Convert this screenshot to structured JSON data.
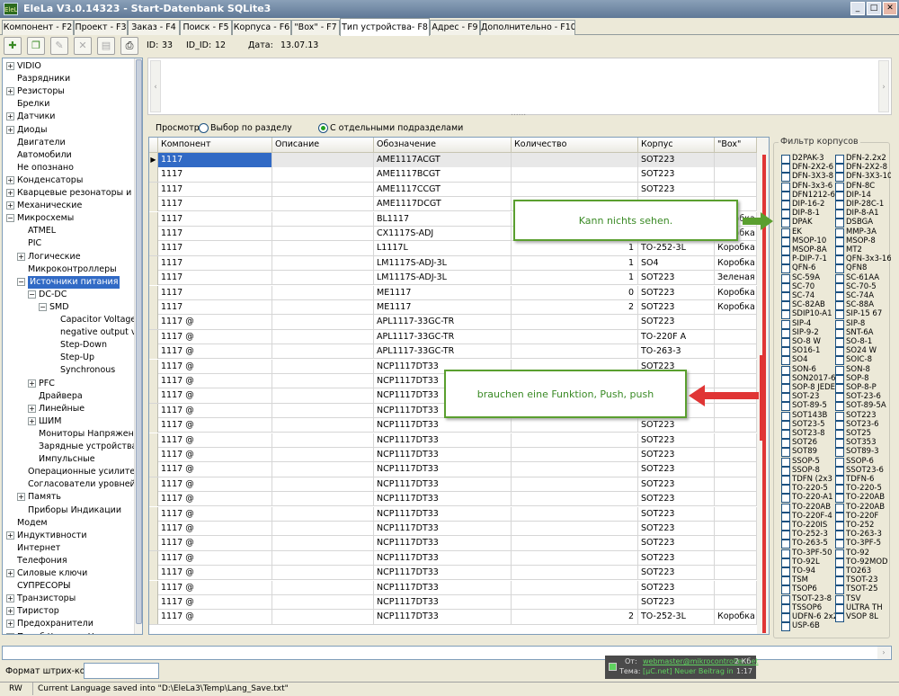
{
  "window": {
    "title": "EleLa V3.0.14323 - Start-Datenbank SQLite3",
    "app_icon_text": "EleLa",
    "minimize_label": "_",
    "maximize_label": "□",
    "close_label": "✕"
  },
  "tabs": [
    {
      "label": "Компонент - F2"
    },
    {
      "label": "Проект - F3"
    },
    {
      "label": "Заказ - F4"
    },
    {
      "label": "Поиск - F5"
    },
    {
      "label": "Корпуса - F6"
    },
    {
      "label": "\"Box\" - F7"
    },
    {
      "label": "Тип устройства- F8"
    },
    {
      "label": "Адрес - F9"
    },
    {
      "label": "Дополнительно - F10"
    }
  ],
  "toolbar": {
    "id_label": "ID:",
    "id_value": "33",
    "id_id_label": "ID_ID:",
    "id_id_value": "12",
    "date_label": "Дата:",
    "date_value": "13.07.13"
  },
  "tree": [
    {
      "label": "VIDIO",
      "expander": "+",
      "level": 0
    },
    {
      "label": "Разрядники",
      "level": 0
    },
    {
      "label": "Резисторы",
      "expander": "+",
      "level": 0
    },
    {
      "label": "Брелки",
      "level": 0
    },
    {
      "label": "Датчики",
      "expander": "+",
      "level": 0
    },
    {
      "label": "Диоды",
      "expander": "+",
      "level": 0
    },
    {
      "label": "Двигатели",
      "level": 0
    },
    {
      "label": "Автомобили",
      "level": 0
    },
    {
      "label": "Не опознано",
      "level": 0
    },
    {
      "label": "Конденсаторы",
      "expander": "+",
      "level": 0
    },
    {
      "label": "Кварцевые резонаторы и Пь",
      "expander": "+",
      "level": 0
    },
    {
      "label": "Механические",
      "expander": "+",
      "level": 0
    },
    {
      "label": "Микросхемы",
      "expander": "−",
      "level": 0
    },
    {
      "label": "ATMEL",
      "level": 1
    },
    {
      "label": "PIC",
      "level": 1
    },
    {
      "label": "Логические",
      "expander": "+",
      "level": 1
    },
    {
      "label": "Микроконтроллеры",
      "level": 1
    },
    {
      "label": "Источники питания",
      "expander": "−",
      "level": 1,
      "selected": true
    },
    {
      "label": "DC-DC",
      "expander": "−",
      "level": 2
    },
    {
      "label": "SMD",
      "expander": "−",
      "level": 3
    },
    {
      "label": "Capacitor Voltage",
      "level": 4
    },
    {
      "label": "negative output vo",
      "level": 4
    },
    {
      "label": "Step-Down",
      "level": 4
    },
    {
      "label": "Step-Up",
      "level": 4
    },
    {
      "label": "Synchronous",
      "level": 4
    },
    {
      "label": "PFC",
      "expander": "+",
      "level": 2
    },
    {
      "label": "Драйвера",
      "level": 2
    },
    {
      "label": "Линейные",
      "expander": "+",
      "level": 2
    },
    {
      "label": "ШИМ",
      "expander": "+",
      "level": 2
    },
    {
      "label": "Мониторы Напряжения",
      "level": 2
    },
    {
      "label": "Зарядные устройства",
      "level": 2
    },
    {
      "label": "Импульсные",
      "level": 2
    },
    {
      "label": "Операционные усилител",
      "level": 1
    },
    {
      "label": "Согласователи уровней",
      "level": 1
    },
    {
      "label": "Память",
      "expander": "+",
      "level": 1
    },
    {
      "label": "Приборы Индикации",
      "level": 1
    },
    {
      "label": "Модем",
      "level": 0
    },
    {
      "label": "Индуктивности",
      "expander": "+",
      "level": 0
    },
    {
      "label": "Интернет",
      "level": 0
    },
    {
      "label": "Телефония",
      "level": 0
    },
    {
      "label": "Силовые ключи",
      "expander": "+",
      "level": 0
    },
    {
      "label": "СУПРЕСОРЫ",
      "level": 0
    },
    {
      "label": "Транзисторы",
      "expander": "+",
      "level": 0
    },
    {
      "label": "Тиристор",
      "expander": "+",
      "level": 0
    },
    {
      "label": "Предохранители",
      "expander": "+",
      "level": 0
    },
    {
      "label": "Преоб Частоты Напряжени",
      "expander": "+",
      "level": 0
    }
  ],
  "view": {
    "label": "Просмотр",
    "option1": "Выбор по разделу",
    "option2": "С отдельными подразделами",
    "dots": "......"
  },
  "grid": {
    "columns": [
      "Компонент",
      "Описание",
      "Обозначение",
      "Количество",
      "Корпус",
      "\"Box\""
    ],
    "rows": [
      [
        "1117",
        "",
        "AME1117ACGT",
        "",
        "SOT223",
        ""
      ],
      [
        "1117",
        "",
        "AME1117BCGT",
        "",
        "SOT223",
        ""
      ],
      [
        "1117",
        "",
        "AME1117CCGT",
        "",
        "SOT223",
        ""
      ],
      [
        "1117",
        "",
        "AME1117DCGT",
        "",
        "",
        ""
      ],
      [
        "1117",
        "",
        "BL1117",
        "",
        "",
        "Коробка А"
      ],
      [
        "1117",
        "",
        "CX1117S-ADJ",
        "",
        "",
        "Коробка А"
      ],
      [
        "1117",
        "",
        "L1117L",
        "1",
        "TO-252-3L",
        "Коробка В"
      ],
      [
        "1117",
        "",
        "LM1117S-ADJ-3L",
        "1",
        "SO4",
        "Коробка А"
      ],
      [
        "1117",
        "",
        "LM1117S-ADJ-3L",
        "1",
        "SOT223",
        "Зеленая ко"
      ],
      [
        "1117",
        "",
        "ME1117",
        "0",
        "SOT223",
        "Коробка А"
      ],
      [
        "1117",
        "",
        "ME1117",
        "2",
        "SOT223",
        "Коробка А"
      ],
      [
        "1117 @",
        "",
        "APL1117-33GC-TR",
        "",
        "SOT223",
        ""
      ],
      [
        "1117 @",
        "",
        "APL1117-33GC-TR",
        "",
        "TO-220F A",
        ""
      ],
      [
        "1117 @",
        "",
        "APL1117-33GC-TR",
        "",
        "TO-263-3",
        ""
      ],
      [
        "1117 @",
        "",
        "NCP1117DT33",
        "",
        "SOT223",
        ""
      ],
      [
        "1117 @",
        "",
        "NCP1117DT33",
        "",
        "",
        ""
      ],
      [
        "1117 @",
        "",
        "NCP1117DT33",
        "",
        "",
        ""
      ],
      [
        "1117 @",
        "",
        "NCP1117DT33",
        "",
        "",
        ""
      ],
      [
        "1117 @",
        "",
        "NCP1117DT33",
        "",
        "SOT223",
        ""
      ],
      [
        "1117 @",
        "",
        "NCP1117DT33",
        "",
        "SOT223",
        ""
      ],
      [
        "1117 @",
        "",
        "NCP1117DT33",
        "",
        "SOT223",
        ""
      ],
      [
        "1117 @",
        "",
        "NCP1117DT33",
        "",
        "SOT223",
        ""
      ],
      [
        "1117 @",
        "",
        "NCP1117DT33",
        "",
        "SOT223",
        ""
      ],
      [
        "1117 @",
        "",
        "NCP1117DT33",
        "",
        "SOT223",
        ""
      ],
      [
        "1117 @",
        "",
        "NCP1117DT33",
        "",
        "SOT223",
        ""
      ],
      [
        "1117 @",
        "",
        "NCP1117DT33",
        "",
        "SOT223",
        ""
      ],
      [
        "1117 @",
        "",
        "NCP1117DT33",
        "",
        "SOT223",
        ""
      ],
      [
        "1117 @",
        "",
        "NCP1117DT33",
        "",
        "SOT223",
        ""
      ],
      [
        "1117 @",
        "",
        "NCP1117DT33",
        "",
        "SOT223",
        ""
      ],
      [
        "1117 @",
        "",
        "NCP1117DT33",
        "",
        "SOT223",
        ""
      ],
      [
        "1117 @",
        "",
        "NCP1117DT33",
        "",
        "SOT223",
        ""
      ],
      [
        "1117 @",
        "",
        "NCP1117DT33",
        "2",
        "TO-252-3L",
        "Коробка А"
      ]
    ]
  },
  "filter": {
    "title": "Фильтр корпусов",
    "left": [
      "D2PAK-3",
      "DFN-2X2-6",
      "DFN-3X3-8",
      "DFN-3x3-6",
      "DFN1212-6",
      "DIP-16-2",
      "DIP-8-1",
      "DPAK",
      "EK",
      "MSOP-10",
      "MSOP-8A",
      "P-DIP-7-1",
      "QFN-6",
      "SC-59A",
      "SC-70",
      "SC-74",
      "SC-82AB",
      "SDIP10-A1",
      "SIP-4",
      "SIP-9-2",
      "SO-8 W",
      "SO16-1",
      "SO4",
      "SON-6",
      "SON2017-6",
      "SOP-8 JEDEC",
      "SOT-23",
      "SOT-89-5",
      "SOT143B",
      "SOT23-5",
      "SOT23-8",
      "SOT26",
      "SOT89",
      "SSOP-5",
      "SSOP-8",
      "TDFN (2x3",
      "TO-220-5",
      "TO-220-A1",
      "TO-220AB",
      "TO-220F-4",
      "TO-220IS",
      "TO-252-3",
      "TO-263-5",
      "TO-3PF-50",
      "TO-92L",
      "TO-94",
      "TSM",
      "TSOP6",
      "TSOT-23-8",
      "TSSOP6",
      "UDFN-6 2x2",
      "USP-6B"
    ],
    "right": [
      "DFN-2.2x2",
      "DFN-2X2-8",
      "DFN-3X3-10",
      "DFN-8C",
      "DIP-14",
      "DIP-28C-1",
      "DIP-8-A1",
      "DSBGA",
      "MMP-3A",
      "MSOP-8",
      "MT2",
      "QFN-3x3-16",
      "QFN8",
      "SC-61AA",
      "SC-70-5",
      "SC-74A",
      "SC-88A",
      "SIP-15 67",
      "SIP-8",
      "SNT-6A",
      "SO-8-1",
      "SO24 W",
      "SOIC-8",
      "SON-8",
      "SOP-8",
      "SOP-8-P",
      "SOT-23-6",
      "SOT-89-5A",
      "SOT223",
      "SOT23-6",
      "SOT25",
      "SOT353",
      "SOT89-3",
      "SSOP-6",
      "SSOT23-6",
      "TDFN-6",
      "TO-220-5",
      "TO-220AB",
      "TO-220AB",
      "TO-220F",
      "TO-252",
      "TO-263-3",
      "TO-3PF-5",
      "TO-92",
      "TO-92MOD",
      "TO263",
      "TSOT-23",
      "TSOT-25",
      "TSV",
      "ULTRA TH",
      "VSOP 8L"
    ]
  },
  "callouts": {
    "top": "Kann nichts sehen.",
    "middle": "brauchen eine Funktion, Push, push"
  },
  "bottom": {
    "barcode_label": "Формат штрих-код"
  },
  "notification": {
    "from_label": "От:",
    "from_value": "webmaster@mikrocontroller.net",
    "size": "2 Кб",
    "subject_label": "Тема:",
    "subject_value": "[µC.net] Neuer Beitrag in \"Ele...",
    "time": "1:17"
  },
  "status": {
    "mode": "RW",
    "message": "Current Language saved into \"D:\\EleLa3\\Temp\\Lang_Save.txt\""
  },
  "colors": {
    "selection": "#316ac5",
    "callout_border": "#5a9f2f",
    "callout_text": "#3a8a25",
    "annotation_red": "#e03535",
    "notify_link": "#5fd35f"
  }
}
